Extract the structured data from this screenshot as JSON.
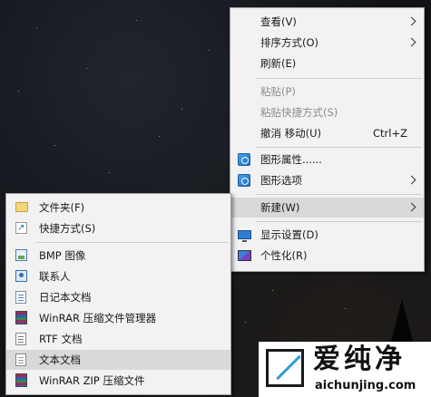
{
  "main_menu": {
    "items": [
      {
        "label": "查看(V)",
        "submenu": true
      },
      {
        "label": "排序方式(O)",
        "submenu": true
      },
      {
        "label": "刷新(E)"
      },
      {
        "label": "粘贴(P)",
        "disabled": true
      },
      {
        "label": "粘贴快捷方式(S)",
        "disabled": true
      },
      {
        "label": "撤消 移动(U)",
        "shortcut": "Ctrl+Z"
      },
      {
        "label": "图形属性......",
        "icon": "graphics-properties-icon"
      },
      {
        "label": "图形选项",
        "icon": "graphics-options-icon",
        "submenu": true
      },
      {
        "label": "新建(W)",
        "submenu": true,
        "highlighted": true
      },
      {
        "label": "显示设置(D)",
        "icon": "display-settings-icon"
      },
      {
        "label": "个性化(R)",
        "icon": "personalize-icon"
      }
    ]
  },
  "new_submenu": {
    "items": [
      {
        "label": "文件夹(F)",
        "icon": "folder-icon"
      },
      {
        "label": "快捷方式(S)",
        "icon": "shortcut-icon"
      },
      {
        "label": "BMP 图像",
        "icon": "bmp-image-icon"
      },
      {
        "label": "联系人",
        "icon": "contact-icon"
      },
      {
        "label": "日记本文档",
        "icon": "journal-document-icon"
      },
      {
        "label": "WinRAR 压缩文件管理器",
        "icon": "winrar-archive-icon"
      },
      {
        "label": "RTF 文档",
        "icon": "rtf-document-icon"
      },
      {
        "label": "文本文档",
        "icon": "text-document-icon",
        "highlighted": true
      },
      {
        "label": "WinRAR ZIP 压缩文件",
        "icon": "winrar-zip-icon"
      }
    ]
  },
  "watermark": {
    "title": "爱纯净",
    "url": "aichunjing.com"
  }
}
